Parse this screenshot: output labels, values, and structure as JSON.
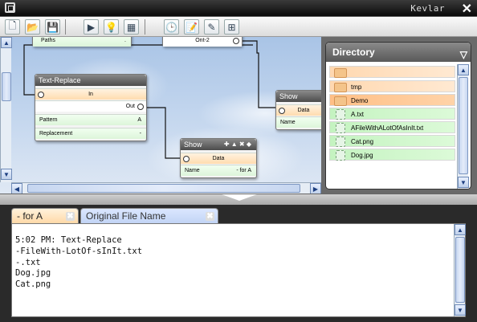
{
  "window": {
    "title": "Kevlar",
    "close_glyph": "✕"
  },
  "toolbar": {
    "buttons": [
      {
        "name": "new-document-icon",
        "glyph": "🗋"
      },
      {
        "name": "open-folder-icon",
        "glyph": "📂"
      },
      {
        "name": "save-disk-icon",
        "glyph": "💾"
      },
      {
        "name": "play-icon",
        "glyph": "▶"
      },
      {
        "name": "bulb-icon",
        "glyph": "💡"
      },
      {
        "name": "grid-icon",
        "glyph": "▦"
      },
      {
        "name": "clock-icon",
        "glyph": "🕒"
      },
      {
        "name": "note-icon",
        "glyph": "📝"
      },
      {
        "name": "pen-icon",
        "glyph": "✎"
      },
      {
        "name": "tree-icon",
        "glyph": "⊞"
      }
    ]
  },
  "canvas": {
    "top_node": {
      "label_left": "Paths",
      "label_right": "."
    },
    "top_node2": {
      "label": "Ont-2"
    },
    "text_replace": {
      "title": "Text-Replace",
      "input": "In",
      "output": "Out",
      "pattern_label": "Pattern",
      "pattern_value": "A",
      "replacement_label": "Replacement",
      "replacement_value": "-"
    },
    "show1": {
      "title": "Show",
      "controls": "✚ ▲ ✖ ◆",
      "input": "Data",
      "name_label": "Name",
      "name_value": "- for A"
    },
    "show2": {
      "title": "Show",
      "input": "Data",
      "name_label": "Name"
    }
  },
  "directory": {
    "title": "Directory",
    "menu_glyph": "▽",
    "items": [
      {
        "type": "folder",
        "label": ""
      },
      {
        "type": "folder",
        "label": "tmp"
      },
      {
        "type": "folder",
        "label": "Demo",
        "selected": true
      },
      {
        "type": "file",
        "label": "A.txt"
      },
      {
        "type": "file",
        "label": "AFileWithALotOfAsInIt.txt"
      },
      {
        "type": "file",
        "label": "Cat.png"
      },
      {
        "type": "file",
        "label": "Dog.jpg"
      }
    ]
  },
  "tabs": [
    {
      "label": "- for A",
      "active": true
    },
    {
      "label": "Original File Name",
      "active": false
    }
  ],
  "log": {
    "text": "5:02 PM: Text-Replace\n-FileWith-LotOf-sInIt.txt\n-.txt\nDog.jpg\nCat.png"
  },
  "colors": {
    "node_title": "#5a5a5a",
    "input_row": "#ffdcaf",
    "param_row": "#ddf5da",
    "folder": "#ffd8b0",
    "file": "#c4f3c0"
  }
}
